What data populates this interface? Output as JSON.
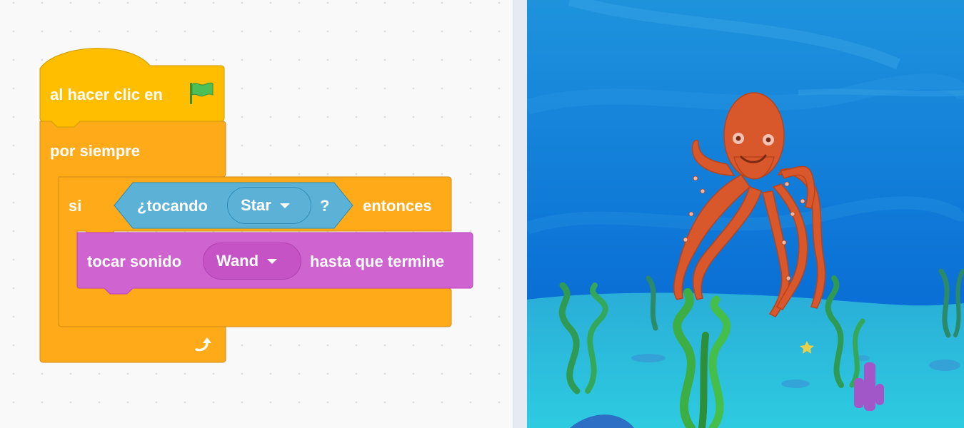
{
  "blocks": {
    "hat_label": "al hacer clic en",
    "forever_label": "por siempre",
    "if_label": "si",
    "touching_label": "¿tocando",
    "touching_target": "Star",
    "question_mark": "?",
    "then_label": "entonces",
    "play_sound_label": "tocar sonido",
    "sound_name": "Wand",
    "until_done_label": "hasta que termine"
  },
  "icons": {
    "flag": "green-flag-icon",
    "loop": "loop-arrow-icon",
    "dropdown": "dropdown-caret-icon"
  },
  "colors": {
    "events": "#ffbf00",
    "control": "#ffab19",
    "sensing": "#5cb1d6",
    "sound": "#cf63cf",
    "stage_water": "#1f8ed8",
    "octopus": "#d9582b"
  }
}
